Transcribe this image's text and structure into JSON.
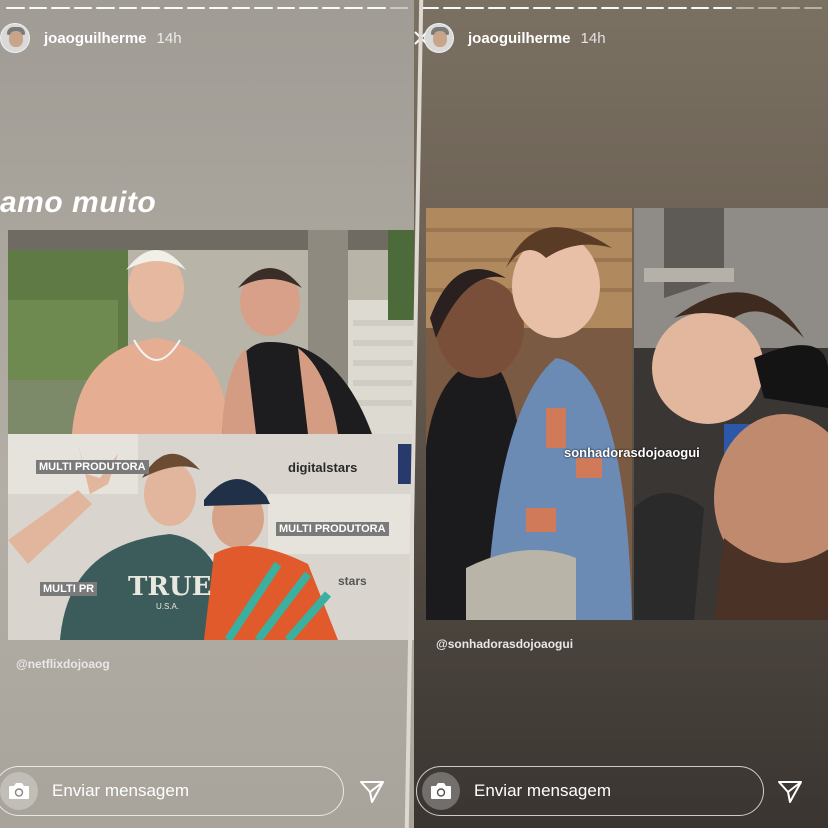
{
  "left_story": {
    "username": "joaoguilherme",
    "time": "14h",
    "caption": "amo muito",
    "mention": "@netflixdojoaog",
    "reply_placeholder": "Enviar mensagem",
    "photo_labels": {
      "backdrop_brand": "digitalstars",
      "backdrop_brand_2": "MULTI PRODUTORA",
      "backdrop_small_1": "MULTI PRODUTORA",
      "backdrop_small_2": "MULTI PR",
      "shirt_text": "TRUE",
      "shirt_subtext": "U.S.A.",
      "stars_fragment": "stars"
    }
  },
  "right_story": {
    "username": "joaoguilherme",
    "time": "14h",
    "photo_watermark": "sonhadorasdojoaogui",
    "mention": "@sonhadorasdojoaogui",
    "reply_placeholder": "Enviar mensagem"
  },
  "progress": {
    "left_segments": 18,
    "left_done": 17,
    "right_segments": 18,
    "right_done": 14
  },
  "icons": [
    "camera-icon",
    "send-icon",
    "close-icon"
  ],
  "colors": {
    "left_bg": "#aaa59d",
    "right_bg": "#5a5147",
    "text": "#ffffff"
  }
}
